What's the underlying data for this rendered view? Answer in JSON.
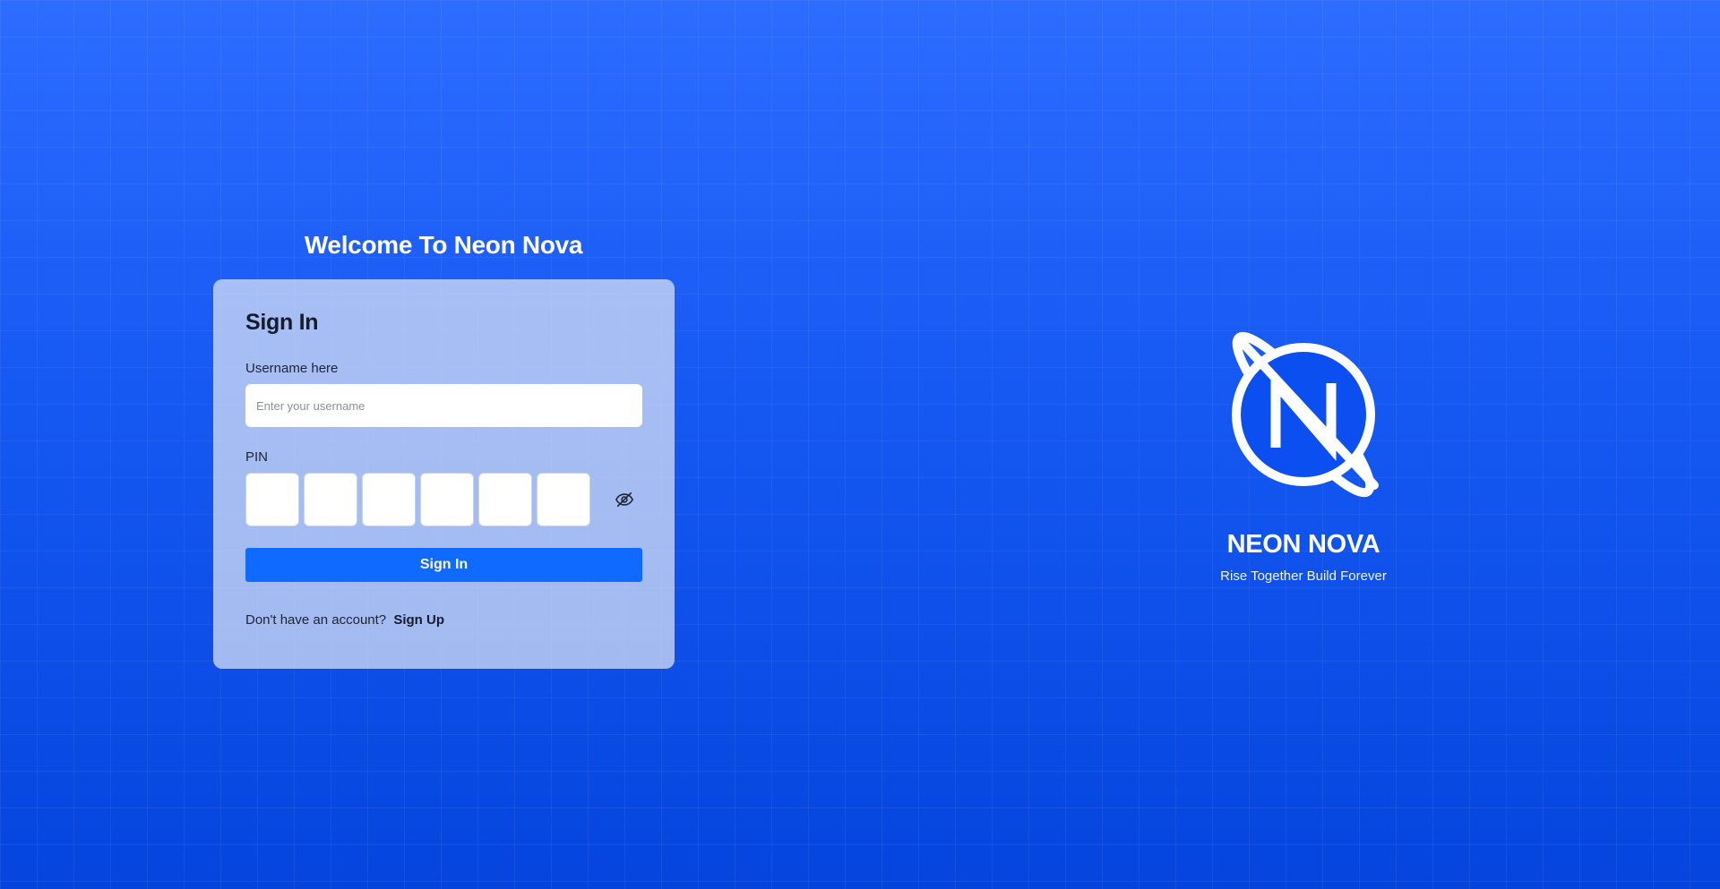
{
  "page": {
    "welcome_title": "Welcome To Neon Nova"
  },
  "signin_card": {
    "title": "Sign In",
    "username_label": "Username here",
    "username_placeholder": "Enter your username",
    "username_value": "",
    "pin_label": "PIN",
    "pin_digits": [
      "",
      "",
      "",
      "",
      "",
      ""
    ],
    "pin_visibility_icon": "eye-off-icon",
    "submit_label": "Sign In",
    "signup_prompt": "Don't have an account?",
    "signup_link_label": "Sign Up"
  },
  "brand": {
    "logo_icon": "planet-n-logo",
    "name": "NEON NOVA",
    "tagline": "Rise Together Build Forever"
  },
  "colors": {
    "background": "#0a4fe6",
    "primary_button": "#0f6aff",
    "card_background": "#dee4f4",
    "text_dark": "#161c2d",
    "white": "#ffffff"
  }
}
